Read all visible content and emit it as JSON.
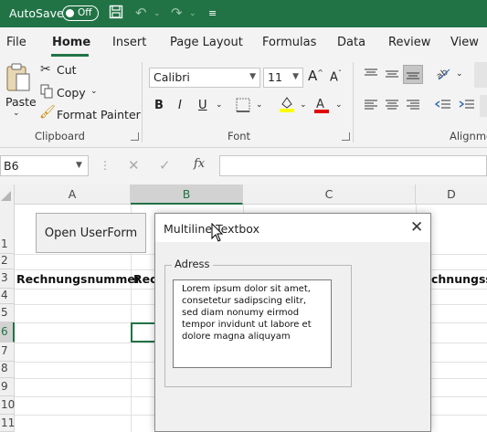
{
  "titlebar": {
    "autosave_label": "AutoSave",
    "autosave_state": "Off"
  },
  "tabs": [
    "File",
    "Home",
    "Insert",
    "Page Layout",
    "Formulas",
    "Data",
    "Review",
    "View"
  ],
  "ribbon": {
    "clipboard": {
      "paste": "Paste",
      "cut": "Cut",
      "copy": "Copy",
      "format_painter": "Format Painter",
      "group_label": "Clipboard"
    },
    "font": {
      "font_name": "Calibri",
      "font_size": "11",
      "group_label": "Font"
    },
    "alignment": {
      "group_label": "Alignme"
    },
    "colors": {
      "accent": "#217346",
      "highlight": "#ffff00",
      "font_color": "#e00000"
    }
  },
  "formula_bar": {
    "name_box": "B6",
    "fx": "fx"
  },
  "grid": {
    "columns": [
      "A",
      "B",
      "C",
      "D"
    ],
    "rows": [
      "1",
      "2",
      "3",
      "4",
      "5",
      "6",
      "7",
      "8",
      "9",
      "10",
      "11"
    ],
    "row3": {
      "a": "Rechnungsnummer",
      "b": "Rech",
      "d": "chnungssp"
    }
  },
  "sheet_button": {
    "label": "Open UserForm"
  },
  "dialog": {
    "title": "Multiline Textbox",
    "frame_caption": "Adress",
    "textbox_value": "Lorem ipsum dolor sit amet, consetetur sadipscing elitr, sed diam nonumy eirmod tempor invidunt ut labore et dolore magna aliquyam"
  }
}
